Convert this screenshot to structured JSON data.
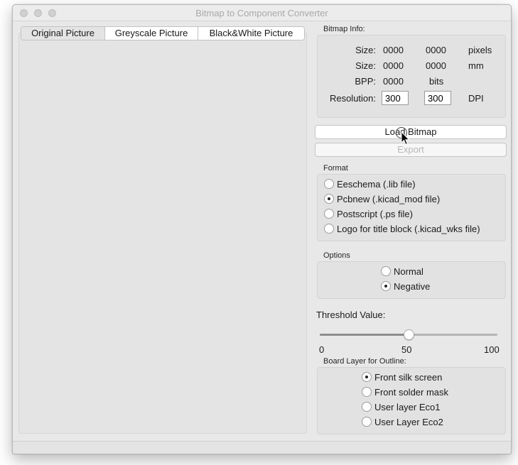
{
  "window": {
    "title": "Bitmap to Component Converter"
  },
  "tabs": [
    {
      "label": "Original Picture",
      "active": true
    },
    {
      "label": "Greyscale Picture",
      "active": false
    },
    {
      "label": "Black&White Picture",
      "active": false
    }
  ],
  "bitmap_info": {
    "label": "Bitmap Info:",
    "size_pixels": {
      "label": "Size:",
      "w": "0000",
      "h": "0000",
      "unit": "pixels"
    },
    "size_mm": {
      "label": "Size:",
      "w": "0000",
      "h": "0000",
      "unit": "mm"
    },
    "bpp": {
      "label": "BPP:",
      "value": "0000",
      "unit": "bits"
    },
    "resolution": {
      "label": "Resolution:",
      "x": "300",
      "y": "300",
      "unit": "DPI"
    }
  },
  "buttons": {
    "load": "Load Bitmap",
    "export": "Export"
  },
  "format": {
    "label": "Format",
    "options": [
      {
        "label": "Eeschema (.lib file)",
        "checked": false
      },
      {
        "label": "Pcbnew (.kicad_mod file)",
        "checked": true
      },
      {
        "label": "Postscript (.ps file)",
        "checked": false
      },
      {
        "label": "Logo for title block (.kicad_wks file)",
        "checked": false
      }
    ]
  },
  "options": {
    "label": "Options",
    "items": [
      {
        "label": "Normal",
        "checked": false
      },
      {
        "label": "Negative",
        "checked": true
      }
    ]
  },
  "threshold": {
    "label": "Threshold Value:",
    "min": "0",
    "value": "50",
    "max": "100",
    "value_num": 50,
    "min_num": 0,
    "max_num": 100
  },
  "board_layer": {
    "label": "Board Layer for Outline:",
    "options": [
      {
        "label": "Front silk screen",
        "checked": true
      },
      {
        "label": "Front solder mask",
        "checked": false
      },
      {
        "label": "User layer Eco1",
        "checked": false
      },
      {
        "label": "User Layer Eco2",
        "checked": false
      }
    ]
  }
}
